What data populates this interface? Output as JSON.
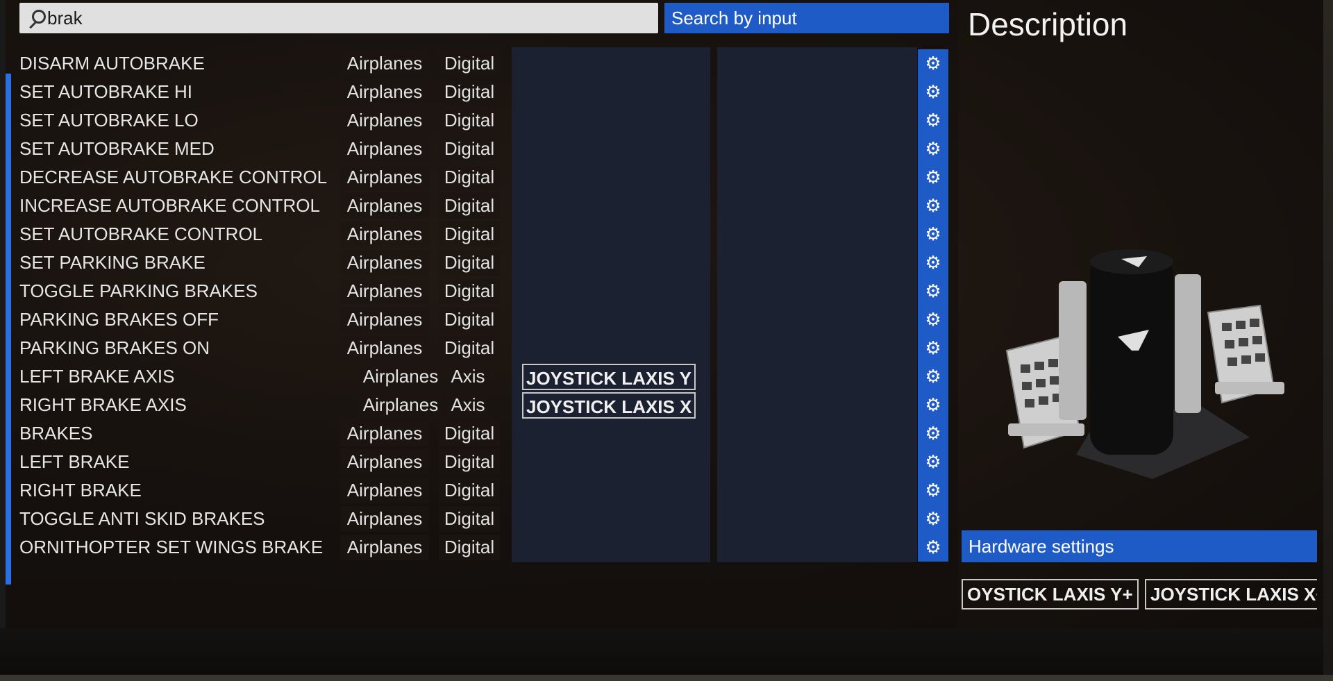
{
  "search": {
    "value": "brak",
    "by_input_label": "Search by input"
  },
  "description": {
    "title": "Description"
  },
  "rows": [
    {
      "name": "DISARM AUTOBRAKE",
      "category": "Airplanes",
      "type": "Digital"
    },
    {
      "name": "SET AUTOBRAKE HI",
      "category": "Airplanes",
      "type": "Digital"
    },
    {
      "name": "SET AUTOBRAKE LO",
      "category": "Airplanes",
      "type": "Digital"
    },
    {
      "name": "SET AUTOBRAKE MED",
      "category": "Airplanes",
      "type": "Digital"
    },
    {
      "name": "DECREASE AUTOBRAKE CONTROL",
      "category": "Airplanes",
      "type": "Digital"
    },
    {
      "name": "INCREASE AUTOBRAKE CONTROL",
      "category": "Airplanes",
      "type": "Digital"
    },
    {
      "name": "SET AUTOBRAKE CONTROL",
      "category": "Airplanes",
      "type": "Digital"
    },
    {
      "name": "SET PARKING BRAKE",
      "category": "Airplanes",
      "type": "Digital"
    },
    {
      "name": "TOGGLE PARKING BRAKES",
      "category": "Airplanes",
      "type": "Digital"
    },
    {
      "name": "PARKING BRAKES OFF",
      "category": "Airplanes",
      "type": "Digital"
    },
    {
      "name": "PARKING BRAKES ON",
      "category": "Airplanes",
      "type": "Digital"
    },
    {
      "name": "LEFT BRAKE AXIS",
      "category": "Airplanes",
      "type": "Axis",
      "binding": "JOYSTICK LAXIS Y"
    },
    {
      "name": "RIGHT BRAKE AXIS",
      "category": "Airplanes",
      "type": "Axis",
      "binding": "JOYSTICK LAXIS X"
    },
    {
      "name": "BRAKES",
      "category": "Airplanes",
      "type": "Digital"
    },
    {
      "name": "LEFT BRAKE",
      "category": "Airplanes",
      "type": "Digital"
    },
    {
      "name": "RIGHT BRAKE",
      "category": "Airplanes",
      "type": "Digital"
    },
    {
      "name": "TOGGLE ANTI SKID BRAKES",
      "category": "Airplanes",
      "type": "Digital"
    },
    {
      "name": "ORNITHOPTER SET WINGS BRAKE",
      "category": "Airplanes",
      "type": "Digital"
    }
  ],
  "hardware": {
    "label": "Hardware settings",
    "tags": [
      "OYSTICK LAXIS Y+",
      "JOYSTICK LAXIS X+"
    ]
  },
  "icons": {
    "row_settings": "gear-icon",
    "search": "search-icon"
  },
  "colors": {
    "accent": "#1f5bc6",
    "slot_bg": "#1b2130"
  }
}
